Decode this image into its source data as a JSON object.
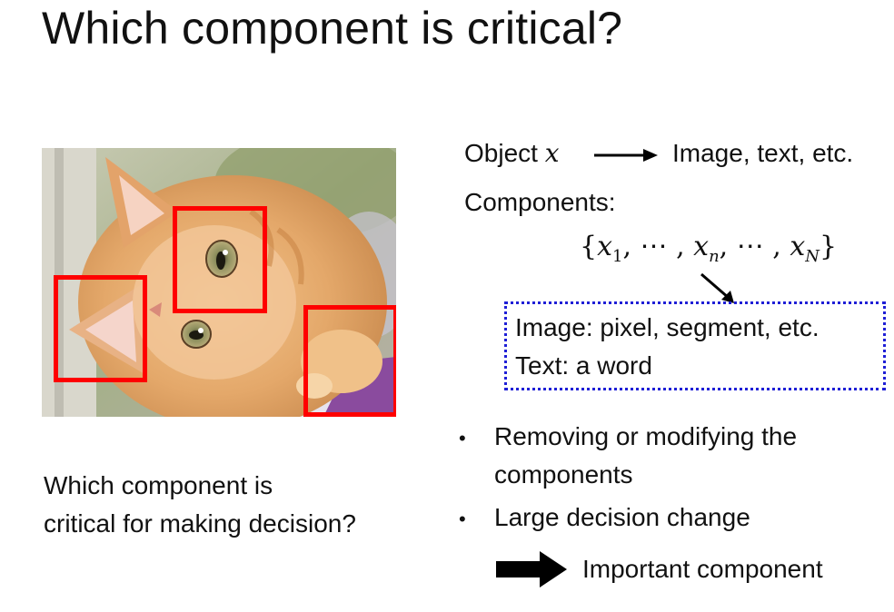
{
  "slide": {
    "title": "Which component is critical?",
    "question_line1": "Which component is",
    "question_line2": "critical for making decision?"
  },
  "definition": {
    "object_label": "Object",
    "object_var": "x",
    "object_target": "Image, text, etc.",
    "components_label": "Components:",
    "set_expression": "{x₁, ⋯ , xₙ, ⋯ , xₙ}",
    "set_open": "{",
    "set_x1": "x",
    "set_sub1": "1",
    "set_sep1": ", ⋯ , ",
    "set_xn": "x",
    "set_subn": "n",
    "set_sep2": ", ⋯ , ",
    "set_xN": "x",
    "set_subN": "N",
    "set_close": "}"
  },
  "examples_box": {
    "line1": "Image: pixel, segment, etc.",
    "line2": "Text: a word",
    "border_color": "#1f1fd6"
  },
  "bullets": [
    {
      "line1": "Removing or modifying the",
      "line2": "components"
    },
    {
      "line1": "Large decision change"
    }
  ],
  "conclusion": "Important component",
  "colors": {
    "highlight_box": "#ff0000",
    "text": "#111111"
  },
  "icons": {
    "bullet": "•"
  }
}
